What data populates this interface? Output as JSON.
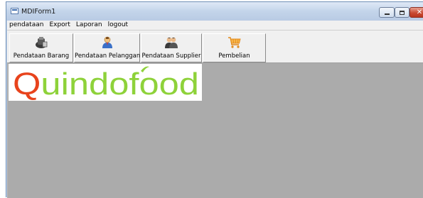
{
  "window": {
    "title": "MDIForm1",
    "minimize_symbol": "–",
    "maximize_symbol": "□",
    "close_symbol": "✕"
  },
  "menu": {
    "items": [
      {
        "label": "pendataan"
      },
      {
        "label": "Export"
      },
      {
        "label": "Laporan"
      },
      {
        "label": "logout"
      }
    ]
  },
  "toolbar": {
    "buttons": [
      {
        "label": "Pendataan Barang",
        "icon": "product-box-icon"
      },
      {
        "label": "Pendataan Pelanggan",
        "icon": "customer-person-icon"
      },
      {
        "label": "Pendataan Supplier",
        "icon": "supplier-people-icon"
      },
      {
        "label": "Pembelian",
        "icon": "shopping-cart-icon"
      }
    ]
  },
  "logo": {
    "text": "Quindofood",
    "colors": {
      "q": "#e8431c",
      "rest": "#8ed23a",
      "leaf": "#8ed23a"
    }
  },
  "colors": {
    "mdi_background": "#ababab",
    "titlebar": "#c5d6ec",
    "close_button": "#c94a33"
  }
}
